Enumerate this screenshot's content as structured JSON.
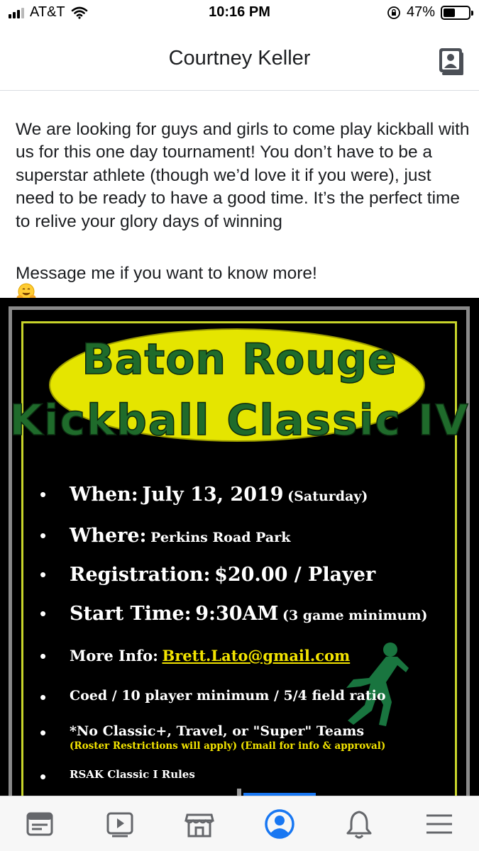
{
  "status_bar": {
    "carrier": "AT&T",
    "time": "10:16 PM",
    "battery_percent": "47%",
    "battery_level": 0.47,
    "icons": [
      "signal-icon",
      "wifi-icon",
      "orientation-lock-icon",
      "battery-icon"
    ]
  },
  "header": {
    "title": "Courtney Keller",
    "icon": "profile-card-icon"
  },
  "post": {
    "text": "We are looking for guys and girls to come play kickball with us for this one day tournament!  You don’t have to be a superstar athlete (though we’d love it if you were), just need to be ready to have a good time. It’s the perfect time to relive your glory days of winning",
    "emoji": "hugging-face-emoji",
    "text2": "Message me if you want to know more!"
  },
  "flyer": {
    "title_line1": "Baton Rouge",
    "title_line2": "Kickball Classic IV",
    "items": [
      {
        "label": "When:",
        "value": "July 13, 2019",
        "extra": "(Saturday)"
      },
      {
        "label": "Where:",
        "value": "Perkins Road Park",
        "extra": ""
      },
      {
        "label": "Registration:",
        "value": "$20.00 / Player",
        "extra": ""
      },
      {
        "label": "Start Time:",
        "value": "9:30AM",
        "extra": "(3 game minimum)"
      },
      {
        "label": "More Info:",
        "value": "Brett.Lato@gmail.com",
        "extra": ""
      },
      {
        "label": "",
        "value": "Coed / 10 player minimum / 5/4 field ratio",
        "extra": ""
      },
      {
        "label": "",
        "value": "*No Classic+, Travel, or \"Super\" Teams",
        "extra": ""
      },
      {
        "label": "",
        "value": "RSAK Classic I Rules",
        "extra": ""
      }
    ],
    "note": "(Roster Restrictions will apply) (Email for info & approval)",
    "colors": {
      "title": "#1f6b2b",
      "ellipse": "#e5e500",
      "link": "#f3e400",
      "frame": "#c8d42a"
    }
  },
  "tab_bar": {
    "tabs": [
      {
        "name": "news-feed-icon"
      },
      {
        "name": "watch-icon"
      },
      {
        "name": "marketplace-icon"
      },
      {
        "name": "profile-icon",
        "active": true
      },
      {
        "name": "notifications-icon"
      },
      {
        "name": "menu-icon"
      }
    ],
    "accent": "#1877f2"
  }
}
